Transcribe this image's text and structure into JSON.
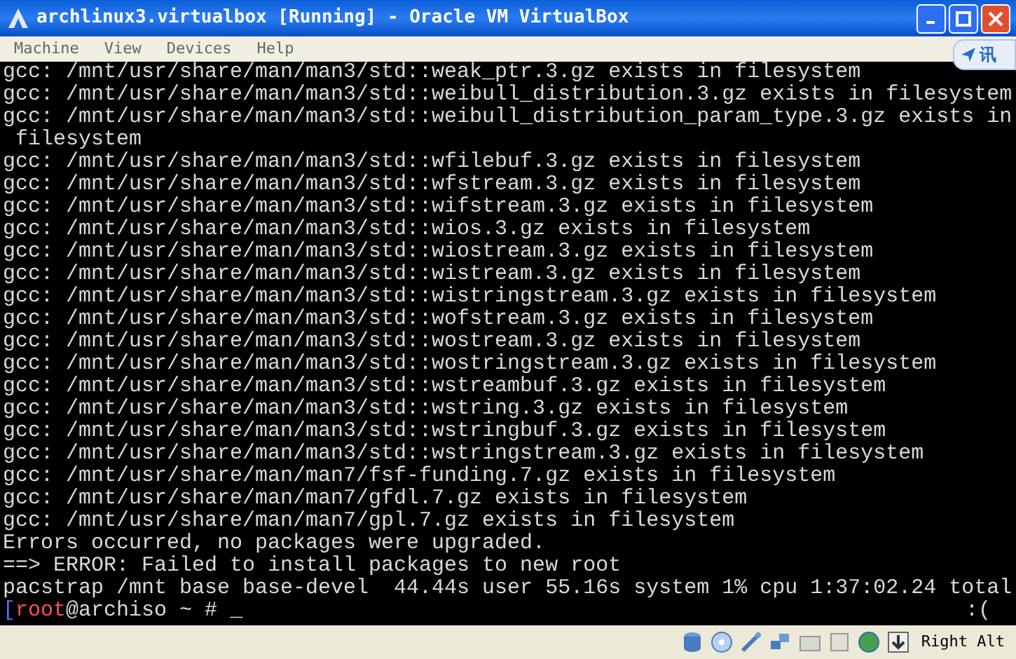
{
  "window": {
    "title": "archlinux3.virtualbox [Running] - Oracle VM VirtualBox"
  },
  "menu": [
    "Machine",
    "View",
    "Devices",
    "Help"
  ],
  "side_tab": {
    "label": "讯"
  },
  "terminal": {
    "lines": [
      {
        "kind": "plain",
        "text": "gcc: /mnt/usr/share/man/man3/std::weak_ptr.3.gz exists in filesystem"
      },
      {
        "kind": "plain",
        "text": "gcc: /mnt/usr/share/man/man3/std::weibull_distribution.3.gz exists in filesystem"
      },
      {
        "kind": "plain",
        "text": "gcc: /mnt/usr/share/man/man3/std::weibull_distribution_param_type.3.gz exists in"
      },
      {
        "kind": "plain",
        "text": " filesystem"
      },
      {
        "kind": "plain",
        "text": "gcc: /mnt/usr/share/man/man3/std::wfilebuf.3.gz exists in filesystem"
      },
      {
        "kind": "plain",
        "text": "gcc: /mnt/usr/share/man/man3/std::wfstream.3.gz exists in filesystem"
      },
      {
        "kind": "plain",
        "text": "gcc: /mnt/usr/share/man/man3/std::wifstream.3.gz exists in filesystem"
      },
      {
        "kind": "plain",
        "text": "gcc: /mnt/usr/share/man/man3/std::wios.3.gz exists in filesystem"
      },
      {
        "kind": "plain",
        "text": "gcc: /mnt/usr/share/man/man3/std::wiostream.3.gz exists in filesystem"
      },
      {
        "kind": "plain",
        "text": "gcc: /mnt/usr/share/man/man3/std::wistream.3.gz exists in filesystem"
      },
      {
        "kind": "plain",
        "text": "gcc: /mnt/usr/share/man/man3/std::wistringstream.3.gz exists in filesystem"
      },
      {
        "kind": "plain",
        "text": "gcc: /mnt/usr/share/man/man3/std::wofstream.3.gz exists in filesystem"
      },
      {
        "kind": "plain",
        "text": "gcc: /mnt/usr/share/man/man3/std::wostream.3.gz exists in filesystem"
      },
      {
        "kind": "plain",
        "text": "gcc: /mnt/usr/share/man/man3/std::wostringstream.3.gz exists in filesystem"
      },
      {
        "kind": "plain",
        "text": "gcc: /mnt/usr/share/man/man3/std::wstreambuf.3.gz exists in filesystem"
      },
      {
        "kind": "plain",
        "text": "gcc: /mnt/usr/share/man/man3/std::wstring.3.gz exists in filesystem"
      },
      {
        "kind": "plain",
        "text": "gcc: /mnt/usr/share/man/man3/std::wstringbuf.3.gz exists in filesystem"
      },
      {
        "kind": "plain",
        "text": "gcc: /mnt/usr/share/man/man3/std::wstringstream.3.gz exists in filesystem"
      },
      {
        "kind": "plain",
        "text": "gcc: /mnt/usr/share/man/man7/fsf-funding.7.gz exists in filesystem"
      },
      {
        "kind": "plain",
        "text": "gcc: /mnt/usr/share/man/man7/gfdl.7.gz exists in filesystem"
      },
      {
        "kind": "plain",
        "text": "gcc: /mnt/usr/share/man/man7/gpl.7.gz exists in filesystem"
      },
      {
        "kind": "plain",
        "text": "Errors occurred, no packages were upgraded."
      },
      {
        "kind": "plain",
        "text": "==> ERROR: Failed to install packages to new root"
      },
      {
        "kind": "plain",
        "text": "pacstrap /mnt base base-devel  44.44s user 55.16s system 1% cpu 1:37:02.24 total"
      }
    ],
    "prompt": {
      "bracket": "[",
      "user": "root",
      "host": "@archiso ~ # ",
      "cursor": "_",
      "status": ":("
    }
  },
  "status_bar": {
    "host_key": "Right Alt"
  }
}
